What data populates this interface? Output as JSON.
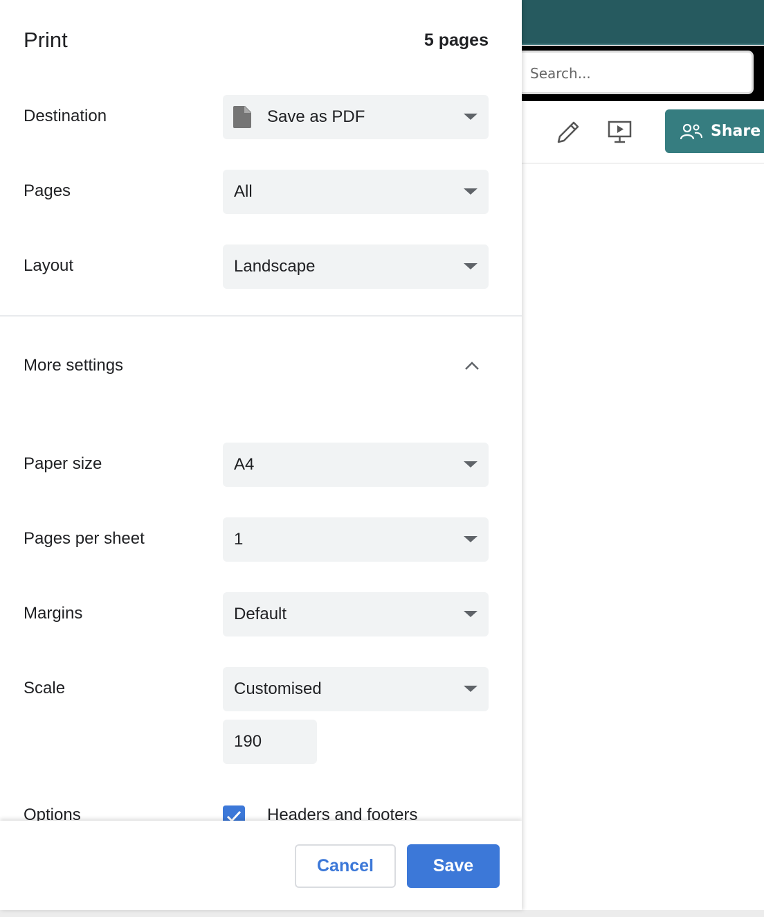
{
  "background_app": {
    "search_placeholder": "Search...",
    "share_label": "Share",
    "colors": {
      "header": "#265a5f",
      "share": "#367d80"
    }
  },
  "dialog": {
    "title": "Print",
    "page_count": "5 pages",
    "destination": {
      "label": "Destination",
      "value": "Save as PDF"
    },
    "pages": {
      "label": "Pages",
      "value": "All"
    },
    "layout": {
      "label": "Layout",
      "value": "Landscape"
    },
    "more_settings": "More settings",
    "paper_size": {
      "label": "Paper size",
      "value": "A4"
    },
    "pages_per_sheet": {
      "label": "Pages per sheet",
      "value": "1"
    },
    "margins": {
      "label": "Margins",
      "value": "Default"
    },
    "scale": {
      "label": "Scale",
      "value": "Customised",
      "custom_value": "190"
    },
    "options": {
      "label": "Options",
      "headers_footers": "Headers and footers",
      "headers_footers_checked": true
    },
    "cancel": "Cancel",
    "save": "Save",
    "accent": "#3c78d8"
  }
}
